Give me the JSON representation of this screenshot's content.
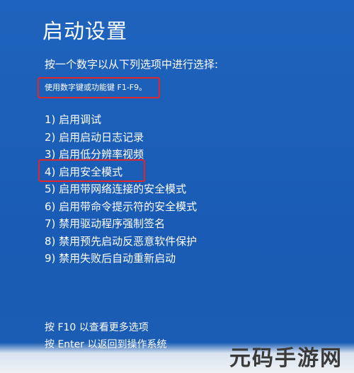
{
  "screen": {
    "title": "启动设置",
    "instruction": "按一个数字以从下列选项中进行选择:",
    "key_hint": "使用数字键或功能键 F1-F9。",
    "options": [
      "1) 启用调试",
      "2) 启用启动日志记录",
      "3) 启用低分辨率视频",
      "4) 启用安全模式",
      "5) 启用带网络连接的安全模式",
      "6) 启用带命令提示符的安全模式",
      "7) 禁用驱动程序强制签名",
      "8) 禁用预先启动反恶意软件保护",
      "9) 禁用失败后自动重新启动"
    ],
    "highlighted_option": "4) 启用安全模式",
    "footer": {
      "more_options": "按 F10 以查看更多选项",
      "return": "按 Enter 以返回到操作系统"
    }
  },
  "watermark": "元码手游网",
  "colors": {
    "background": "#1c5fb8",
    "highlight_border": "#e0262b",
    "text": "#ffffff"
  }
}
